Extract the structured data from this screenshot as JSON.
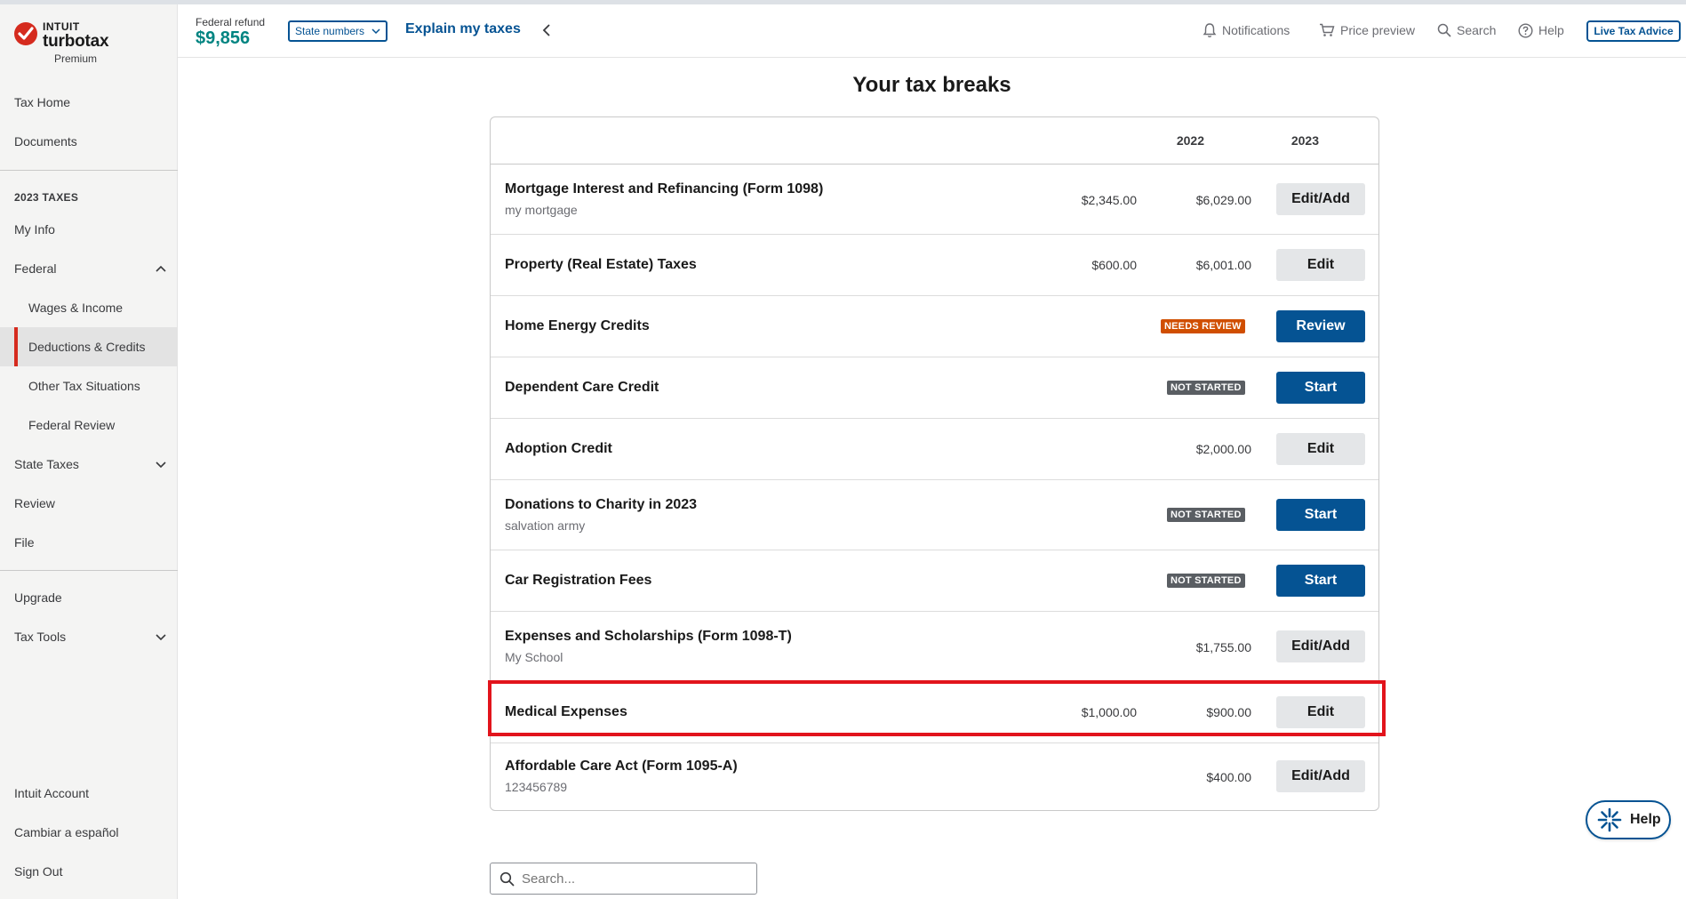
{
  "brand": {
    "intuit": "INTUIT",
    "product": "turbotax",
    "edition": "Premium",
    "accent": "#d52b1e"
  },
  "header": {
    "refund_label": "Federal refund",
    "refund_amount": "$9,856",
    "state_select": "State numbers",
    "explain_link": "Explain my taxes",
    "tools": {
      "notifications": "Notifications",
      "price_preview": "Price preview",
      "search": "Search",
      "help": "Help"
    },
    "live_advice": "Live Tax Advice"
  },
  "sidebar": {
    "tax_home": "Tax Home",
    "documents": "Documents",
    "section_heading": "2023 TAXES",
    "my_info": "My Info",
    "federal": "Federal",
    "federal_sub": [
      "Wages & Income",
      "Deductions & Credits",
      "Other Tax Situations",
      "Federal Review"
    ],
    "state_taxes": "State Taxes",
    "review": "Review",
    "file": "File",
    "upgrade": "Upgrade",
    "tax_tools": "Tax Tools",
    "intuit_account": "Intuit Account",
    "spanish": "Cambiar a español",
    "sign_out": "Sign Out"
  },
  "main": {
    "title": "Your tax breaks",
    "col_2022": "2022",
    "col_2023": "2023",
    "rows": [
      {
        "title": "Mortgage Interest and Refinancing (Form 1098)",
        "sub": "my mortgage",
        "v2022": "$2,345.00",
        "v2023": "$6,029.00",
        "button": "Edit/Add"
      },
      {
        "title": "Property (Real Estate) Taxes",
        "v2022": "$600.00",
        "v2023": "$6,001.00",
        "button": "Edit"
      },
      {
        "title": "Home Energy Credits",
        "badge": "NEEDS REVIEW",
        "button": "Review"
      },
      {
        "title": "Dependent Care Credit",
        "badge": "NOT STARTED",
        "button": "Start"
      },
      {
        "title": "Adoption Credit",
        "v2023": "$2,000.00",
        "button": "Edit"
      },
      {
        "title": "Donations to Charity in 2023",
        "sub": "salvation army",
        "badge": "NOT STARTED",
        "button": "Start"
      },
      {
        "title": "Car Registration Fees",
        "badge": "NOT STARTED",
        "button": "Start"
      },
      {
        "title": "Expenses and Scholarships (Form 1098-T)",
        "sub": "My School",
        "v2023": "$1,755.00",
        "button": "Edit/Add"
      },
      {
        "title": "Medical Expenses",
        "v2022": "$1,000.00",
        "v2023": "$900.00",
        "button": "Edit"
      },
      {
        "title": "Affordable Care Act (Form 1095-A)",
        "sub": "123456789",
        "v2023": "$400.00",
        "button": "Edit/Add"
      }
    ],
    "search_placeholder": "Search..."
  },
  "help_fab": "Help",
  "colors": {
    "primary_blue": "#055393",
    "refund_green": "#008481",
    "needs_review": "#d04e00",
    "not_started": "#5a5e63",
    "highlight_red": "#e2141c"
  }
}
